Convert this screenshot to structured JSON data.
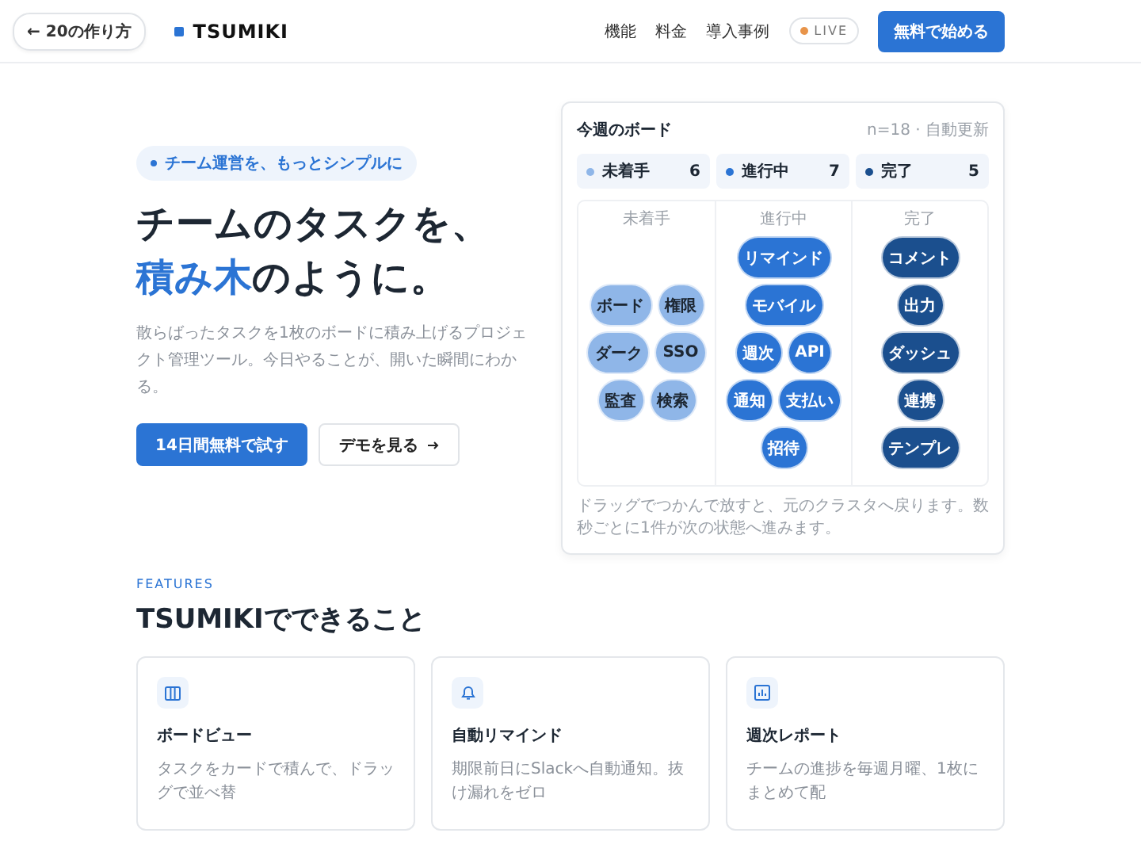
{
  "header": {
    "back_link": "← 20の作り方",
    "logo": "TSUMIKI",
    "nav": [
      "機能",
      "料金",
      "導入事例"
    ],
    "live_badge": "LIVE",
    "cta": "無料で始める"
  },
  "hero": {
    "badge": "チーム運営を、もっとシンプルに",
    "headline_line1": "チームのタスクを、",
    "headline_accent": "積み木",
    "headline_rest": "のように。",
    "description": "散らばったタスクを1枚のボードに積み上げるプロジェクト管理ツール。今日やることが、開いた瞬間にわかる。",
    "primary_button": "14日間無料で試す",
    "secondary_button": "デモを見る"
  },
  "board": {
    "title": "今週のボード",
    "meta": "n=18 · 自動更新",
    "columns": [
      {
        "legend_label": "未着手",
        "count": "6",
        "heading": "未着手",
        "color": "#8fb6e8",
        "tasks": [
          "ボード",
          "権限",
          "ダーク",
          "SSO",
          "監査",
          "検索"
        ]
      },
      {
        "legend_label": "進行中",
        "count": "7",
        "heading": "進行中",
        "color": "#2b74d4",
        "tasks": [
          "リマインド",
          "モバイル",
          "週次",
          "API",
          "通知",
          "支払い",
          "招待"
        ]
      },
      {
        "legend_label": "完了",
        "count": "5",
        "heading": "完了",
        "color": "#1b4f8e",
        "tasks": [
          "コメント",
          "出力",
          "ダッシュ",
          "連携",
          "テンプレ"
        ]
      }
    ],
    "note": "ドラッグでつかんで放すと、元のクラスタへ戻ります。数秒ごとに1件が次の状態へ進みます。"
  },
  "features": {
    "eyebrow": "FEATURES",
    "title": "TSUMIKIでできること",
    "cards": [
      {
        "title": "ボードビュー",
        "description": "タスクをカードで積んで、ドラッグで並べ替"
      },
      {
        "title": "自動リマインド",
        "description": "期限前日にSlackへ自動通知。抜け漏れをゼロ"
      },
      {
        "title": "週次レポート",
        "description": "チームの進捗を毎週月曜、1枚にまとめて配"
      }
    ]
  }
}
